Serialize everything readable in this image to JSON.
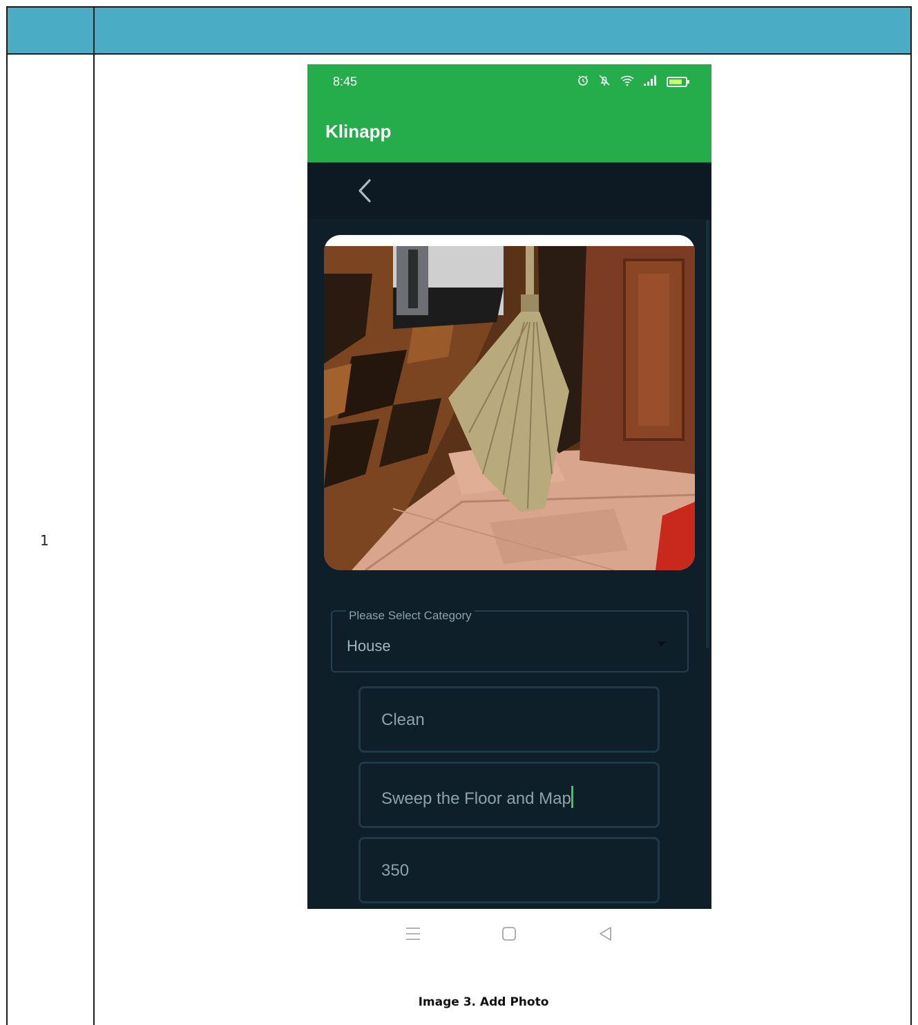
{
  "document": {
    "row_number": "1",
    "caption": "Image 3. Add Photo"
  },
  "phone": {
    "status_bar": {
      "time": "8:45",
      "battery_level": "77",
      "icons": [
        "alarm-icon",
        "mute-icon",
        "wifi-icon",
        "signal-icon",
        "battery-icon"
      ]
    },
    "app_bar": {
      "title": "Klinapp"
    },
    "toolbar": {
      "back_icon": "chevron-left-icon"
    },
    "form": {
      "photo": "broom-photo",
      "category": {
        "label": "Please Select Category",
        "value": "House"
      },
      "fields": [
        {
          "value": "Clean"
        },
        {
          "value": "Sweep the Floor and Map"
        },
        {
          "value": "350"
        }
      ]
    },
    "nav_bar": {
      "icons": [
        "menu-icon",
        "home-icon",
        "back-icon"
      ]
    },
    "colors": {
      "app_green": "#24ad4a",
      "background": "#0f1f29",
      "cursor": "#33cc55"
    }
  }
}
